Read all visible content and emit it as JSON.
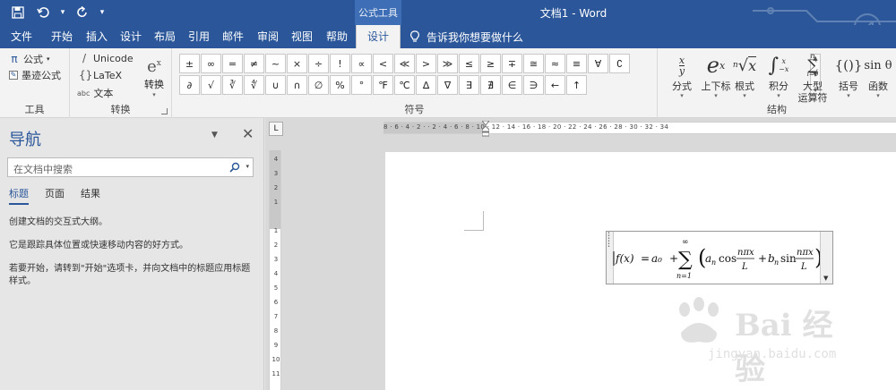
{
  "quick_access": {
    "save_icon": "save-icon",
    "undo_icon": "undo-icon",
    "redo_icon": "redo-icon",
    "customize_icon": "customize-icon"
  },
  "title": {
    "context": "公式工具",
    "document": "文档1 - Word"
  },
  "tabs": [
    {
      "label": "文件"
    },
    {
      "label": "开始"
    },
    {
      "label": "插入"
    },
    {
      "label": "设计"
    },
    {
      "label": "布局"
    },
    {
      "label": "引用"
    },
    {
      "label": "邮件"
    },
    {
      "label": "审阅"
    },
    {
      "label": "视图"
    },
    {
      "label": "帮助"
    },
    {
      "label": "设计",
      "active": true
    }
  ],
  "tell_me": "告诉我你想要做什么",
  "ribbon": {
    "tools": {
      "equation": "公式",
      "ink_equation": "墨迹公式",
      "label": "工具"
    },
    "conversions": {
      "unicode": "Unicode",
      "latex": "LaTeX",
      "text": "文本",
      "convert": "转换",
      "label": "转换"
    },
    "symbols": {
      "label": "符号",
      "row1": [
        "±",
        "∞",
        "=",
        "≠",
        "~",
        "×",
        "÷",
        "!",
        "∝",
        "<",
        "≪",
        ">",
        "≫",
        "≤",
        "≥",
        "∓",
        "≅",
        "≈",
        "≡",
        "∀"
      ],
      "row2": [
        "∁",
        "∂",
        "√",
        "∛",
        "∜",
        "∪",
        "∩",
        "∅",
        "%",
        "°",
        "℉",
        "℃",
        "∆",
        "∇",
        "∃",
        "∄",
        "∈",
        "∋",
        "←",
        "↑"
      ]
    },
    "structures": {
      "label": "结构",
      "items": [
        {
          "label": "分式"
        },
        {
          "label": "上下标"
        },
        {
          "label": "根式"
        },
        {
          "label": "积分"
        },
        {
          "label": "大型\n运算符"
        },
        {
          "label": "括号"
        },
        {
          "label": "函数"
        }
      ]
    }
  },
  "nav": {
    "title": "导航",
    "search_placeholder": "在文档中搜索",
    "tabs": [
      "标题",
      "页面",
      "结果"
    ],
    "lines": [
      "创建文档的交互式大纲。",
      "它是跟踪具体位置或快速移动内容的好方式。",
      "若要开始，请转到\"开始\"选项卡，并向文档中的标题应用标题样式。"
    ]
  },
  "ruler": {
    "horizontal": "8 · 6 · 4 · 2 ·  · 2 · 4 · 6 · 8 · 10 · 12 · 14 · 16 · 18 · 20 · 22 · 24 · 26 · 28 · 30 · 32 · 34",
    "vertical": [
      "4",
      "3",
      "2",
      "1",
      "",
      "1",
      "2",
      "3",
      "4",
      "5",
      "6",
      "7",
      "8",
      "9",
      "10",
      "11"
    ],
    "tab_selector": "L"
  },
  "equation": {
    "lhs": "f(x)",
    "const": "a₀",
    "sum_upper": "∞",
    "sum_lower": "n=1",
    "an": "a",
    "an_sub": "n",
    "cos": "cos",
    "bn": "b",
    "bn_sub": "n",
    "sin": "sin",
    "num": "nπx",
    "den": "L"
  },
  "watermark": {
    "main": "Bai 经验",
    "sub": "jingyan.baidu.com"
  }
}
